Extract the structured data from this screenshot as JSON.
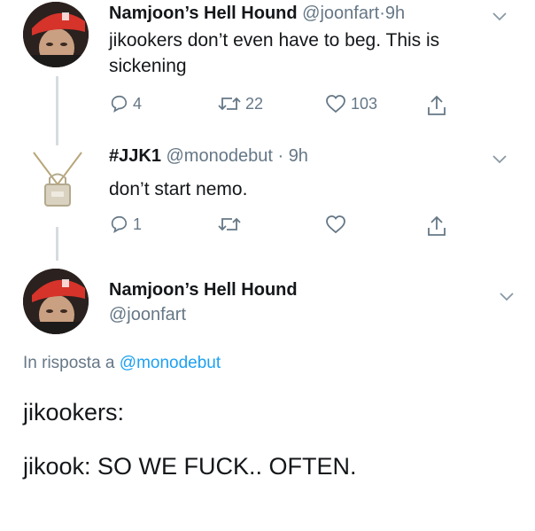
{
  "tweet1": {
    "name": "Namjoon’s Hell Hound",
    "handle": "@joonfart",
    "sep": "·",
    "time": "9h",
    "text_line1": "jikookers don’t even have to beg.  This is",
    "text_line2": "sickening",
    "replies": "4",
    "retweets": "22",
    "likes": "103"
  },
  "tweet2": {
    "name": "#JJK1",
    "handle": "@monodebut",
    "sep": "·",
    "time": "9h",
    "text": "don’t start nemo.",
    "replies": "1"
  },
  "tweet3": {
    "name": "Namjoon’s Hell Hound",
    "handle": "@joonfart",
    "reply_prefix": "In risposta a",
    "reply_handle": "@monodebut",
    "line1": "jikookers:",
    "line2": "jikook: SO WE FUCK..  OFTEN."
  },
  "colors": {
    "text": "#14171a",
    "muted": "#657786",
    "link": "#1da1f2",
    "thread_line": "#d6dbdf",
    "avatar_cap": "#d6332b"
  },
  "icons": [
    "chevron-down-icon",
    "reply-icon",
    "retweet-icon",
    "like-icon",
    "share-icon"
  ]
}
